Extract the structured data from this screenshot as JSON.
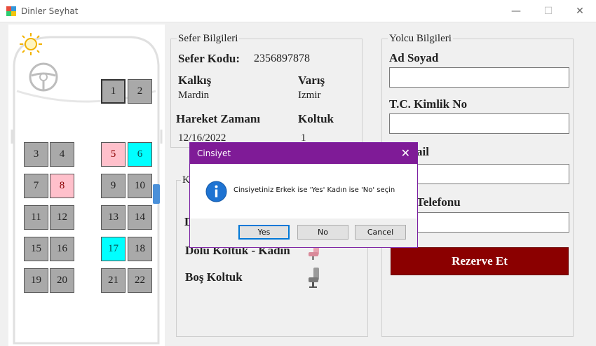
{
  "window": {
    "title": "Dinler Seyhat",
    "minimize": "—",
    "maximize": "☐",
    "close": "✕"
  },
  "seats": [
    {
      "number": "1",
      "state": "empty",
      "selected": true
    },
    {
      "number": "2",
      "state": "empty"
    },
    {
      "number": "3",
      "state": "empty"
    },
    {
      "number": "4",
      "state": "empty"
    },
    {
      "number": "5",
      "state": "female"
    },
    {
      "number": "6",
      "state": "male"
    },
    {
      "number": "7",
      "state": "empty"
    },
    {
      "number": "8",
      "state": "female"
    },
    {
      "number": "9",
      "state": "empty"
    },
    {
      "number": "10",
      "state": "empty"
    },
    {
      "number": "11",
      "state": "empty"
    },
    {
      "number": "12",
      "state": "empty"
    },
    {
      "number": "13",
      "state": "empty"
    },
    {
      "number": "14",
      "state": "empty"
    },
    {
      "number": "15",
      "state": "empty"
    },
    {
      "number": "16",
      "state": "empty"
    },
    {
      "number": "17",
      "state": "male"
    },
    {
      "number": "18",
      "state": "empty"
    },
    {
      "number": "19",
      "state": "empty"
    },
    {
      "number": "20",
      "state": "empty"
    },
    {
      "number": "21",
      "state": "empty"
    },
    {
      "number": "22",
      "state": "empty"
    }
  ],
  "sefer": {
    "group_title": "Sefer Bilgileri",
    "kod_label": "Sefer Kodu:",
    "kod_value": "2356897878",
    "kalkis_label": "Kalkış",
    "kalkis_value": "Mardin",
    "varis_label": "Varış",
    "varis_value": "Izmir",
    "zaman_label": "Hareket Zamanı",
    "zaman_value": "12/16/2022",
    "koltuk_label": "Koltuk",
    "koltuk_value": "1"
  },
  "legend": {
    "group_title_partial": "K",
    "dolu_erkek_partial": "D",
    "dolu_kadin": "Dolu Koltuk - Kadın",
    "bos": "Boş Koltuk"
  },
  "yolcu": {
    "group_title": "Yolcu Bilgileri",
    "ad_soyad_label": "Ad Soyad",
    "ad_soyad_value": "",
    "tc_label": "T.C. Kimlik No",
    "tc_value": "",
    "email_label_partial": "ail",
    "email_value": "",
    "telefon_label_partial": "Telefonu",
    "telefon_value": "",
    "reserve_button": "Rezerve Et"
  },
  "dialog": {
    "title": "Cinsiyet",
    "message": "Cinsiyetiniz Erkek ise 'Yes' Kadın ise 'No' seçin",
    "yes": "Yes",
    "no": "No",
    "cancel": "Cancel"
  },
  "colors": {
    "seat_empty": "#a9a9a9",
    "seat_female": "#ffc0cb",
    "seat_male": "#00ffff",
    "reserve_button": "#8b0000",
    "dialog_titlebar": "#7f1b97"
  }
}
